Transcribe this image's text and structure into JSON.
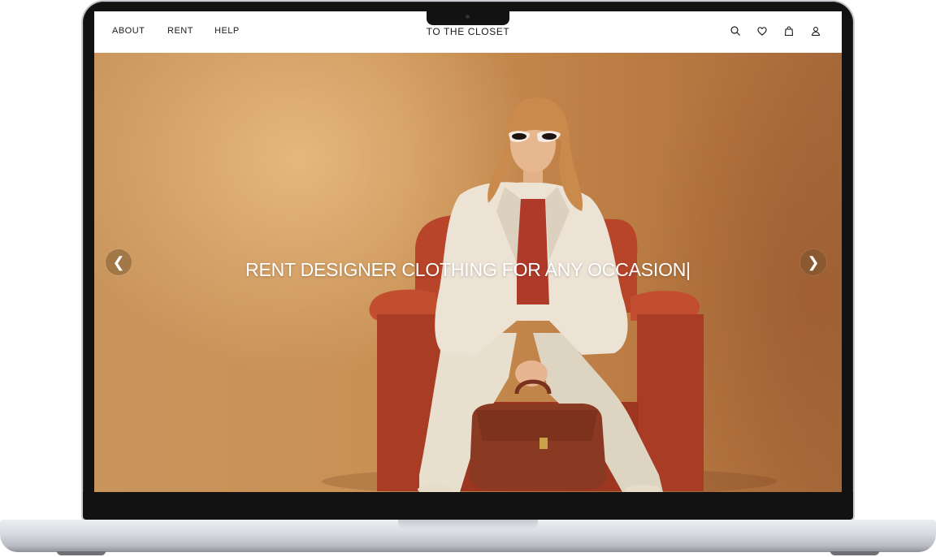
{
  "nav": {
    "left_links": [
      "ABOUT",
      "RENT",
      "HELP"
    ],
    "brand": "TO THE CLOSET",
    "icons": [
      "search-icon",
      "heart-icon",
      "bag-icon",
      "user-icon"
    ]
  },
  "hero": {
    "headline": "RENT DESIGNER CLOTHING FOR ANY OCCASION|",
    "prev_arrow": "❮",
    "next_arrow": "❯"
  },
  "colors": {
    "nav_background": "#ffffff",
    "hero_background": "#c48c53",
    "chair": "#b8452a",
    "suit": "#ece3d4",
    "bag": "#8a3a22",
    "headline": "#ffffff"
  }
}
